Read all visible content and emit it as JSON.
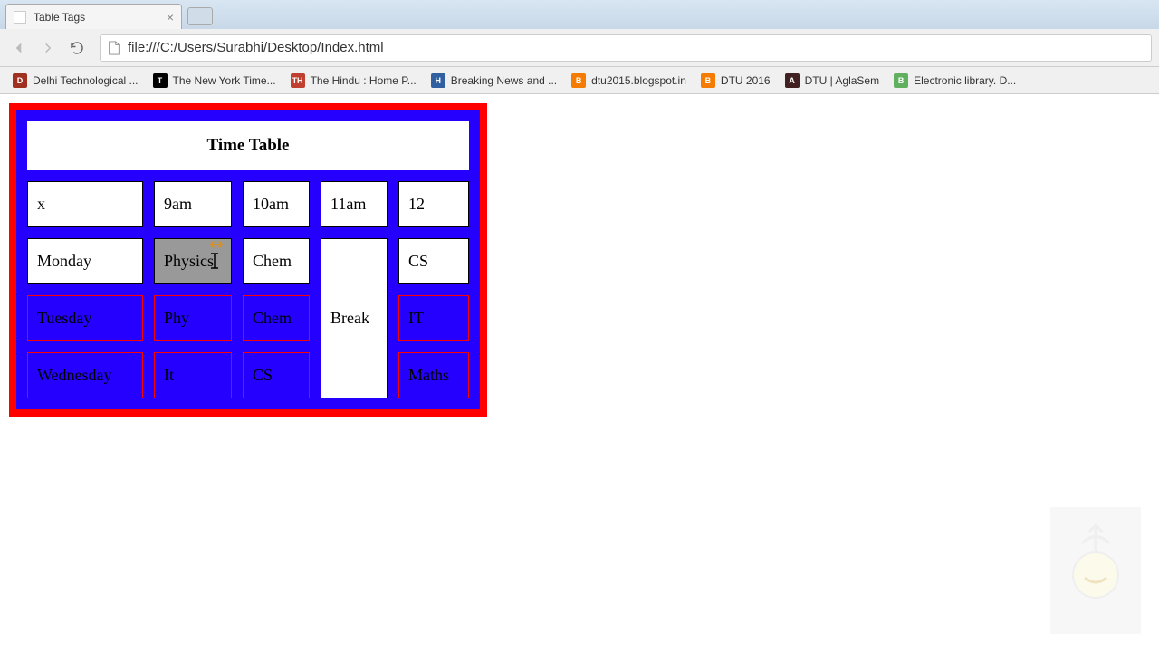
{
  "browser": {
    "tab_title": "Table Tags",
    "url": "file:///C:/Users/Surabhi/Desktop/Index.html",
    "bookmarks": [
      {
        "label": "Delhi Technological ...",
        "icon_bg": "#a03020",
        "icon_txt": "D"
      },
      {
        "label": "The New York Time...",
        "icon_bg": "#000",
        "icon_txt": "T"
      },
      {
        "label": "The Hindu : Home P...",
        "icon_bg": "#c04030",
        "icon_txt": "TH"
      },
      {
        "label": "Breaking News and ...",
        "icon_bg": "#3060a0",
        "icon_txt": "H"
      },
      {
        "label": "dtu2015.blogspot.in",
        "icon_bg": "#f57c00",
        "icon_txt": "B"
      },
      {
        "label": "DTU 2016",
        "icon_bg": "#f57c00",
        "icon_txt": "B"
      },
      {
        "label": "DTU | AglaSem",
        "icon_bg": "#402020",
        "icon_txt": "A"
      },
      {
        "label": "Electronic library. D...",
        "icon_bg": "#60b060",
        "icon_txt": "B"
      }
    ]
  },
  "table": {
    "caption": "Time Table",
    "header": [
      "x",
      "9am",
      "10am",
      "11am",
      "12"
    ],
    "rows": [
      {
        "day": "Monday",
        "c1": "Physics",
        "c2": "Chem",
        "c4": "CS",
        "style": "white",
        "highlight_c1": true
      },
      {
        "day": "Tuesday",
        "c1": "Phy",
        "c2": "Chem",
        "c4": "IT",
        "style": "blue"
      },
      {
        "day": "Wednesday",
        "c1": "It",
        "c2": "CS",
        "c4": "Maths",
        "style": "blue"
      }
    ],
    "break_label": "Break"
  }
}
